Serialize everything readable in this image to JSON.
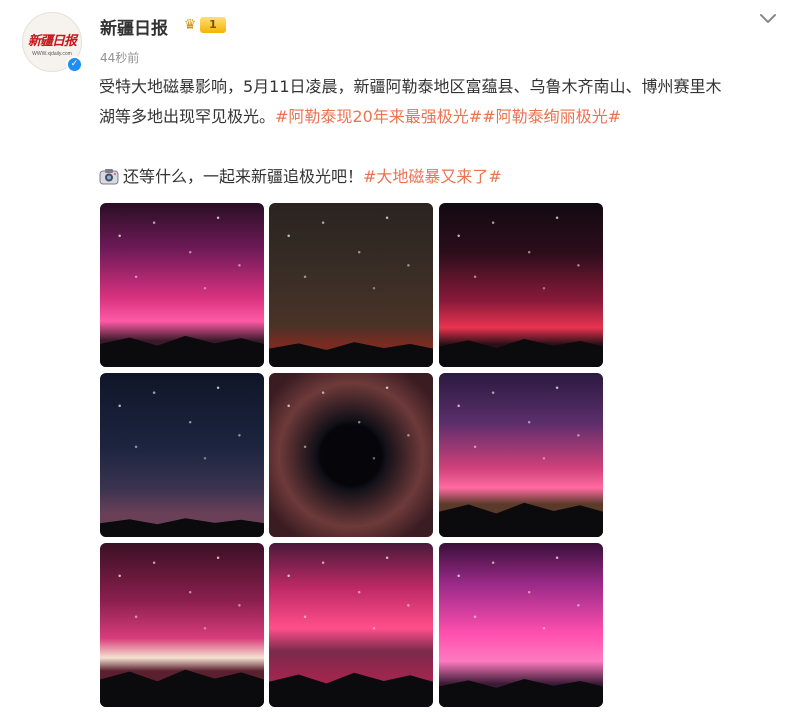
{
  "post": {
    "username": "新疆日报",
    "badge_level": "1",
    "timestamp": "44秒前",
    "avatar": {
      "logo_text": "新疆日报",
      "url_text": "WWW.xjdaily.com"
    },
    "content": {
      "line1": "受特大地磁暴影响，5月11日凌晨，新疆阿勒泰地区富蕴县、乌鲁木齐南山、博州赛里木",
      "line2_text": "湖等多地出现罕见极光。",
      "hashtag1": "#阿勒泰现20年来最强极光#",
      "hashtag2": "#阿勒泰绚丽极光#",
      "line3_text": "还等什么，一起来新疆追极光吧！",
      "hashtag3": "#大地磁暴又来了#"
    },
    "colors": {
      "hashtag": "#eb7350",
      "text": "#333333",
      "meta": "#939393",
      "verified": "#1f8ef1"
    },
    "icons": [
      "verified-icon",
      "crown-icon",
      "chevron-down-icon",
      "camera-icon"
    ]
  },
  "photos": [
    {
      "name": "photo-1",
      "sky": "linear-gradient(180deg,#2a0e24 0%,#6e1a58 28%,#d9327f 58%,#ff5aa6 72%,#3a1a2a 84%)",
      "land": 20
    },
    {
      "name": "photo-2",
      "sky": "linear-gradient(180deg,#2a2320 0%,#3a2e26 45%,#4a3226 75%,#7a2c22 86%)",
      "land": 16
    },
    {
      "name": "photo-3",
      "sky": "linear-gradient(180deg,#120a12 0%,#2b0d1a 30%,#8a1a3a 60%,#e8334f 76%,#2a1016 86%)",
      "land": 18
    },
    {
      "name": "photo-4",
      "sky": "linear-gradient(180deg,#101628 0%,#1c2440 45%,#3a3350 70%,#6a4058 86%)",
      "land": 12
    },
    {
      "name": "photo-5",
      "sky": "radial-gradient(circle at 50% 50%,#05050a 0 26%,#111018 30%,#3a2226 44%,#6e3a3a 62%,#3a1c22 85%)",
      "land": 0
    },
    {
      "name": "photo-6",
      "sky": "linear-gradient(180deg,#2a1a40 0%,#5a2e6a 30%,#d0407a 58%,#ff6aa0 70%,#5a3a2a 80%)",
      "land": 22
    },
    {
      "name": "photo-7",
      "sky": "linear-gradient(180deg,#3a1024 0%,#8a1f4e 35%,#d83c7a 58%,#f5e1d0 70%,#5a2030 78%)",
      "land": 24
    },
    {
      "name": "photo-8",
      "sky": "linear-gradient(180deg,#4a1a3a 0%,#c02a66 28%,#ff4f8a 52%,#7a2a4a 66%,#a0264e 82%)",
      "land": 22
    },
    {
      "name": "photo-9",
      "sky": "linear-gradient(180deg,#3a0f3a 0%,#9a2a88 25%,#ff4fae 55%,#ff7ac0 72%,#3a1a34 86%)",
      "land": 18
    }
  ]
}
